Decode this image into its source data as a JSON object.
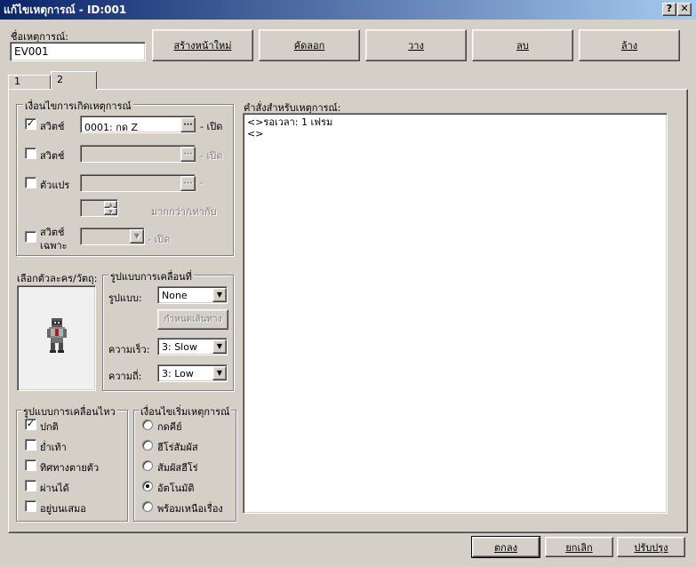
{
  "window": {
    "title": "แก้ไขเหตุการณ์ - ID:001",
    "help_btn": "?",
    "close_btn": "✕"
  },
  "event_name": {
    "label": "ชื่อเหตุการณ์:",
    "value": "EV001"
  },
  "page_buttons": {
    "new": "สร้างหน้าใหม่",
    "copy": "คัดลอก",
    "paste": "วาง",
    "delete": "ลบ",
    "clear": "ล้าง"
  },
  "tabs": [
    "1",
    "2"
  ],
  "conditions": {
    "legend": "เงื่อนไขการเกิดเหตุการณ์",
    "switch1": {
      "label": "สวิตช์",
      "checked": true,
      "value": "0001: กด Z",
      "suffix": "- เปิด"
    },
    "switch2": {
      "label": "สวิตช์",
      "checked": false,
      "value": "",
      "suffix": "- เปิด"
    },
    "variable": {
      "label": "ตัวแปร",
      "checked": false,
      "value": "",
      "suffix": "-"
    },
    "compare_text": "มากกว่า/เท่ากับ",
    "self_switch": {
      "label_line1": "สวิตช์",
      "label_line2": "เฉพาะ",
      "checked": false,
      "value": "",
      "suffix": "- เปิด"
    }
  },
  "graphic": {
    "label": "เลือกตัวละคร/วัตถุ:"
  },
  "movement": {
    "legend": "รูปแบบการเคลื่อนที่",
    "type_label": "รูปแบบ:",
    "type_value": "None",
    "route_button": "กำหนดเส้นทาง",
    "speed_label": "ความเร็ว:",
    "speed_value": "3: Slow",
    "freq_label": "ความถี่:",
    "freq_value": "3: Low"
  },
  "options": {
    "legend": "รูปแบบการเคลื่อนไหว",
    "items": [
      {
        "label": "ปกติ",
        "checked": true
      },
      {
        "label": "ย่ำเท้า",
        "checked": false
      },
      {
        "label": "ทิศทางตายตัว",
        "checked": false
      },
      {
        "label": "ผ่านได้",
        "checked": false
      },
      {
        "label": "อยู่บนเสมอ",
        "checked": false
      }
    ]
  },
  "trigger": {
    "legend": "เงื่อนไขเริ่มเหตุการณ์",
    "items": [
      {
        "label": "กดคีย์",
        "selected": false
      },
      {
        "label": "ฮีโร่สัมผัส",
        "selected": false
      },
      {
        "label": "สัมผัสฮีโร่",
        "selected": false
      },
      {
        "label": "อัตโนมัติ",
        "selected": true
      },
      {
        "label": "พร้อมเหนือเรื่อง",
        "selected": false
      }
    ]
  },
  "commands": {
    "label": "คำสั่งสำหรับเหตุการณ์:",
    "lines": [
      "<>รอเวลา: 1 เฟรม",
      "<>"
    ]
  },
  "footer": {
    "ok": "ตกลง",
    "cancel": "ยกเลิก",
    "apply": "ปรับปรุง"
  }
}
